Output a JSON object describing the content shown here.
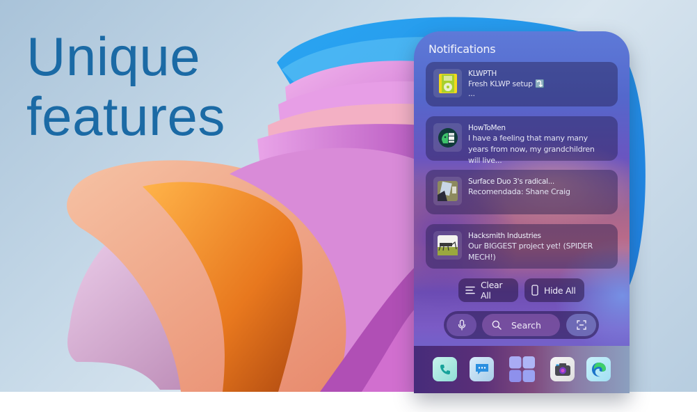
{
  "hero": {
    "headline_line1": "Unique",
    "headline_line2": "features",
    "headline_color": "#1b6aa5"
  },
  "phone": {
    "title": "Notifications",
    "notifications": [
      {
        "app": "KLWPTH",
        "text": "Fresh KLWP setup ⤵️",
        "extra": "...",
        "icon": "klwp-ipod-icon"
      },
      {
        "app": "HowToMen",
        "text": "I have a feeling that many many years from now, my grandchildren will live...",
        "icon": "howtomen-android-icon"
      },
      {
        "app": "Surface Duo 3's radical...",
        "text": "Recomendada: Shane Craig",
        "icon": "video-thumbnail-icon"
      },
      {
        "app": "Hacksmith Industries",
        "text": "Our BIGGEST project yet! (SPIDER MECH!)",
        "icon": "spider-mech-thumbnail-icon"
      }
    ],
    "actions": {
      "clear_all": "Clear All",
      "hide_all": "Hide All"
    },
    "search": {
      "placeholder": "Search"
    },
    "dock": [
      {
        "name": "Phone",
        "icon": "phone-icon"
      },
      {
        "name": "Messages",
        "icon": "messages-icon"
      },
      {
        "name": "App drawer",
        "icon": "app-grid-icon"
      },
      {
        "name": "Camera",
        "icon": "camera-icon"
      },
      {
        "name": "Edge",
        "icon": "edge-browser-icon"
      }
    ]
  }
}
